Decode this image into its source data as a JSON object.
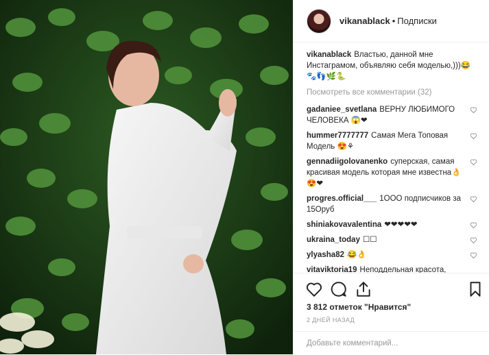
{
  "header": {
    "username": "vikanablack",
    "separator": "•",
    "follow_label": "Подписки"
  },
  "caption": {
    "username": "vikanablack",
    "text": "Властью, данной мне Инстаграмом, объявляю себя моделью,)))😂🐾👣🌿🐍"
  },
  "view_all": "Посмотреть все комментарии (32)",
  "comments": [
    {
      "user": "gadaniee_svetlana",
      "text": "ВЕРНУ ЛЮБИМОГО ЧЕЛОВЕКА 😱❤"
    },
    {
      "user": "hummer7777777",
      "text": "Самая Мега Топовая Модель 😍⚘"
    },
    {
      "user": "gennadiigolovanenko",
      "text": "суперская, самая красивая модель которая мне известна👌😍❤"
    },
    {
      "user": "progres.official___",
      "text": "1ООО подписчиков за 15Оруб"
    },
    {
      "user": "shiniakovavalentina",
      "text": "❤❤❤❤❤"
    },
    {
      "user": "ukraina_today",
      "text": "☐☐"
    },
    {
      "user": "ylyasha82",
      "text": "😂👌"
    },
    {
      "user": "vitaviktoria19",
      "text": "Неподдельная красота,"
    }
  ],
  "likes": "3 812 отметок \"Нравится\"",
  "time": "2 ДНЕЙ НАЗАД",
  "add_comment_placeholder": "Добавьте комментарий..."
}
